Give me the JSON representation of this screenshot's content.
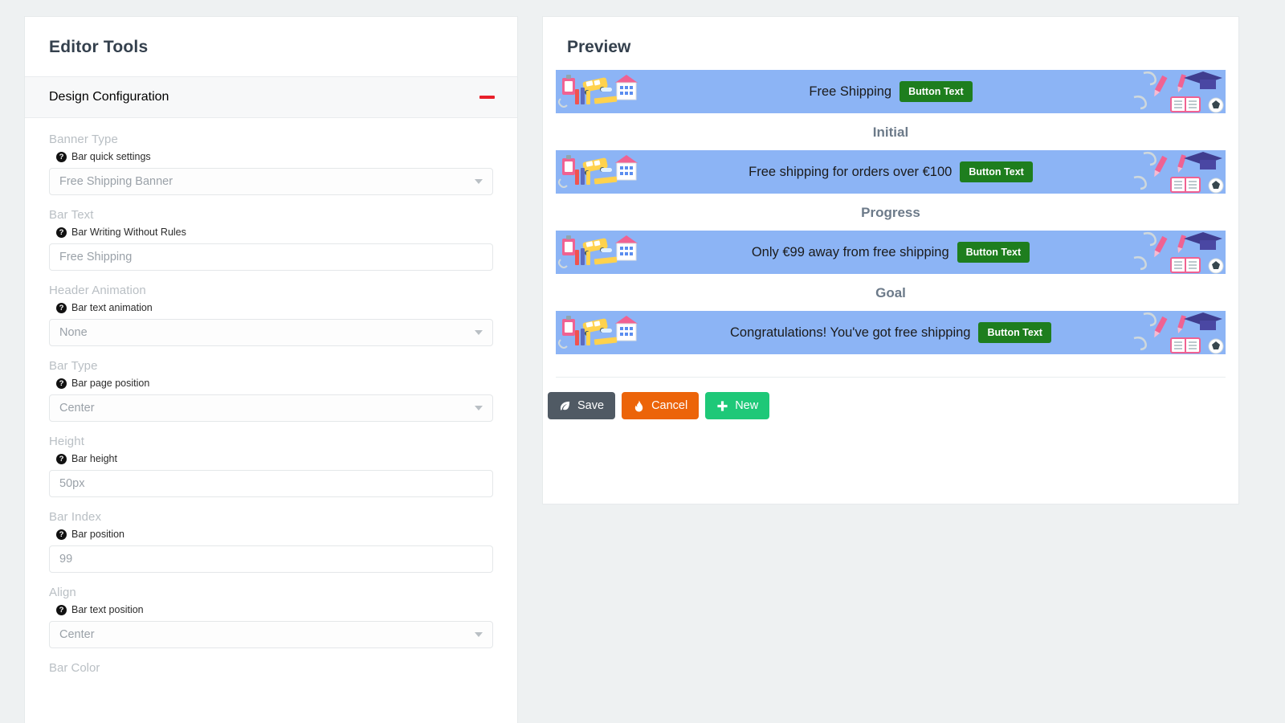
{
  "editor": {
    "title": "Editor Tools",
    "accordion": {
      "title": "Design Configuration",
      "collapse_icon": "minus-icon"
    },
    "fields": [
      {
        "label": "Banner Type",
        "help": "Bar quick settings",
        "value": "Free Shipping Banner",
        "type": "select"
      },
      {
        "label": "Bar Text",
        "help": "Bar Writing Without Rules",
        "value": "Free Shipping",
        "type": "text"
      },
      {
        "label": "Header Animation",
        "help": "Bar text animation",
        "value": "None",
        "type": "select"
      },
      {
        "label": "Bar Type",
        "help": "Bar page position",
        "value": "Center",
        "type": "select"
      },
      {
        "label": "Height",
        "help": "Bar height",
        "value": "50px",
        "type": "text"
      },
      {
        "label": "Bar Index",
        "help": "Bar position",
        "value": "99",
        "type": "text"
      },
      {
        "label": "Align",
        "help": "Bar text position",
        "value": "Center",
        "type": "select"
      }
    ],
    "cut_off_label": "Bar Color"
  },
  "preview": {
    "title": "Preview",
    "button_label": "Button Text",
    "main_banner": {
      "text": "Free Shipping"
    },
    "stages": [
      {
        "label": "Initial",
        "text": "Free shipping for orders over €100"
      },
      {
        "label": "Progress",
        "text": "Only €99 away from free shipping"
      },
      {
        "label": "Goal",
        "text": "Congratulations! You've got free shipping"
      }
    ],
    "actions": [
      {
        "label": "Save",
        "icon": "leaf-icon"
      },
      {
        "label": "Cancel",
        "icon": "fire-icon"
      },
      {
        "label": "New",
        "icon": "plus-icon"
      }
    ]
  },
  "colors": {
    "accent_red": "#e8202a",
    "banner_blue": "#8cb4f5",
    "button_green": "#1e7e1e",
    "save_gray": "#505a64",
    "cancel_orange": "#ec6409",
    "new_green": "#1ec878"
  }
}
